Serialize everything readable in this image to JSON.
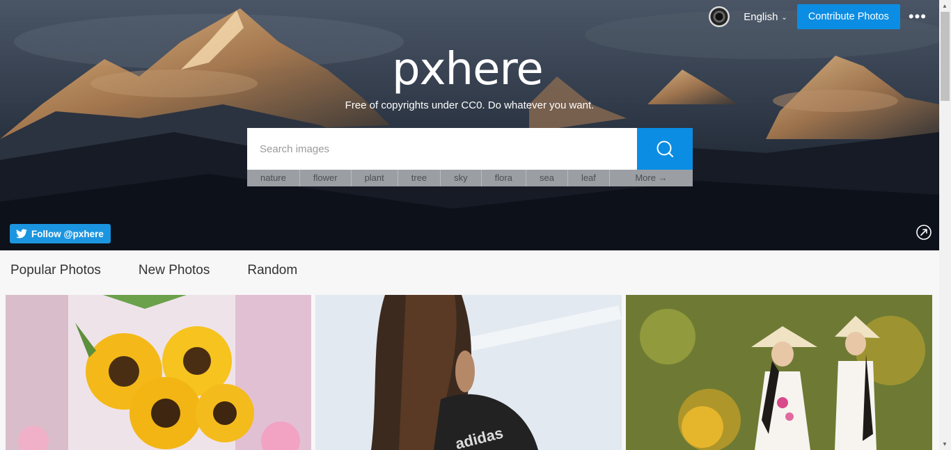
{
  "header": {
    "language": "English",
    "contribute_label": "Contribute Photos",
    "more_label": "•••"
  },
  "hero": {
    "logo": "pxhere",
    "tagline": "Free of copyrights under CC0. Do whatever you want.",
    "search_placeholder": "Search images",
    "tags": [
      "nature",
      "flower",
      "plant",
      "tree",
      "sky",
      "flora",
      "sea",
      "leaf",
      "More →"
    ],
    "follow_label": "Follow @pxhere"
  },
  "nav": {
    "tabs": [
      "Popular Photos",
      "New Photos",
      "Random"
    ]
  },
  "colors": {
    "accent": "#0b8de3",
    "twitter": "#1b95e0"
  }
}
